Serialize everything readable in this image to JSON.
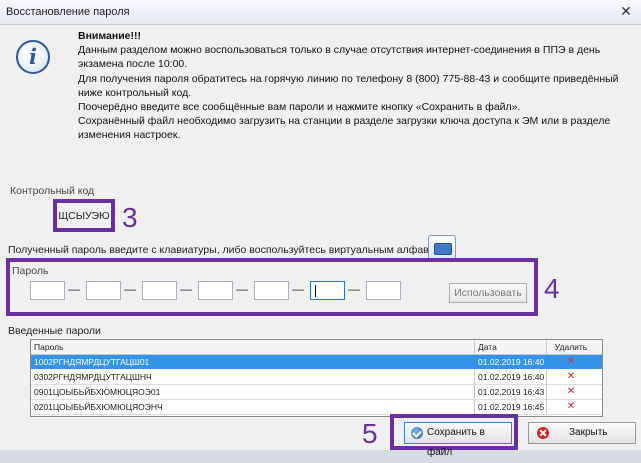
{
  "window": {
    "title": "Восстановление пароля",
    "close_glyph": "✕"
  },
  "message": {
    "warning": "Внимание!!!",
    "lines": [
      "Данным разделом можно воспользоваться только в случае отсутствия интернет-соединения в ППЭ в день экзамена после 10:00.",
      "Для получения пароля обратитесь на горячую линию по телефону 8 (800) 775-88-43 и сообщите приведённый ниже контрольный код.",
      "Поочерёдно введите все сообщённые вам пароли и нажмите кнопку «Сохранить в файл».",
      "Сохранённый файл необходимо загрузить на станции в разделе загрузки ключа доступа к ЭМ или в разделе изменения настроек."
    ]
  },
  "control_code": {
    "label": "Контрольный код",
    "value": "ЩСЫУЭЮ"
  },
  "annotations": {
    "a3": "3",
    "a4": "4",
    "a5": "5"
  },
  "instruction": "Полученный пароль введите с клавиатуры, либо воспользуйтесь виртуальным алфавитом.",
  "password": {
    "label": "Пароль",
    "segments": [
      "",
      "",
      "",
      "",
      "",
      "",
      ""
    ],
    "dash": "—",
    "use_button": "Использовать"
  },
  "entered": {
    "label": "Введенные пароли",
    "columns": [
      "Пароль",
      "Дата",
      "Удалить"
    ],
    "rows": [
      {
        "password": "1002РГНДЯМРДЦУТГАЦШ01",
        "date": "01.02.2019 16:40",
        "delete": "✕"
      },
      {
        "password": "0302РГНДЯМРДЦУТГАЦШНЧ",
        "date": "01.02.2019 16:40",
        "delete": "✕"
      },
      {
        "password": "0901ЦОЫБЬЙБХЮМЮЦЯОЭ01",
        "date": "01.02.2019 16:43",
        "delete": "✕"
      },
      {
        "password": "0201ЦОЫБЬЙБХЮМЮЦЯОЭНЧ",
        "date": "01.02.2019 16:45",
        "delete": "✕"
      }
    ]
  },
  "buttons": {
    "save": "Сохранить в файл",
    "close": "Закрыть"
  },
  "colors": {
    "annotation": "#6a2fa0",
    "selection": "#3393e8",
    "delete": "#d51d1d"
  }
}
